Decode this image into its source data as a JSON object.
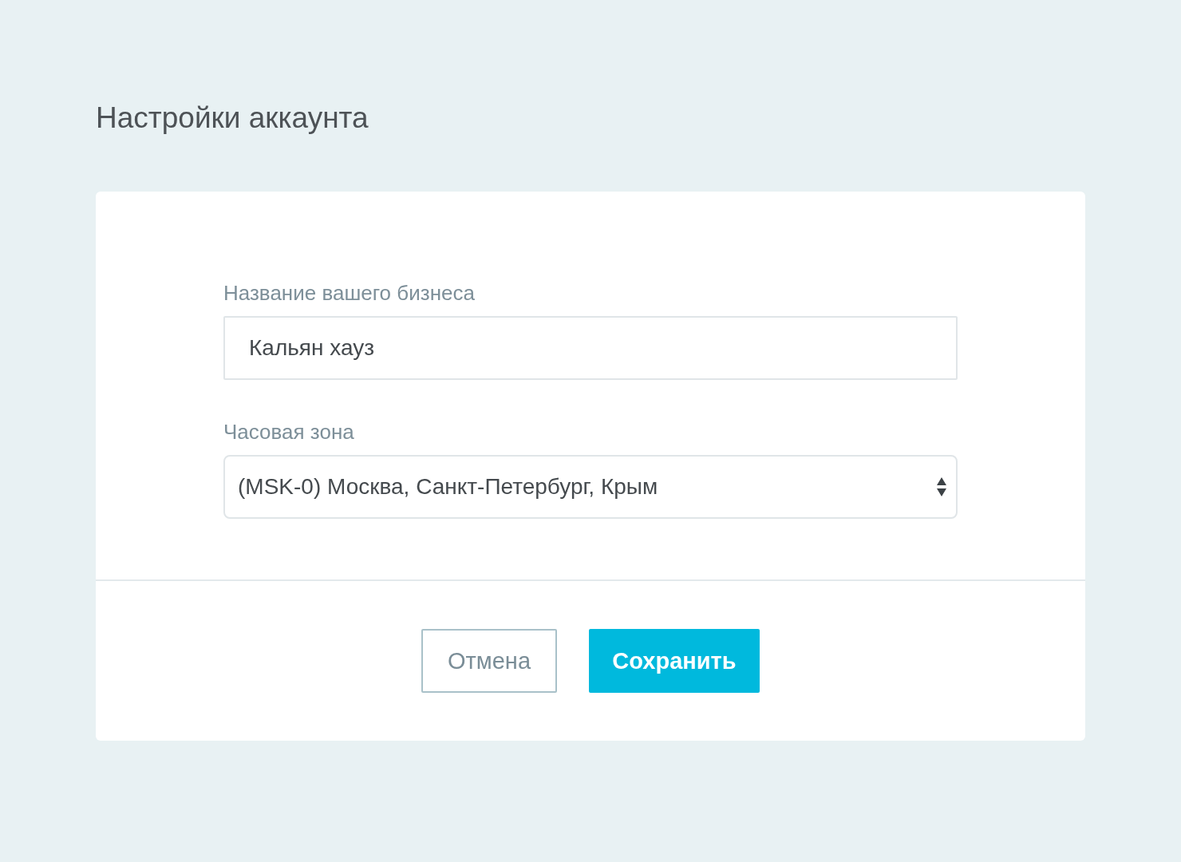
{
  "title": "Настройки аккаунта",
  "fields": [
    {
      "kind": "text",
      "label": "Название вашего бизнеса",
      "value": "Кальян хауз"
    },
    {
      "kind": "select",
      "label": "Часовая зона",
      "value": "(MSK-0) Москва, Санкт-Петербург, Крым"
    }
  ],
  "buttons": [
    {
      "kind": "secondary",
      "label": "Отмена"
    },
    {
      "kind": "primary",
      "label": "Сохранить"
    }
  ]
}
